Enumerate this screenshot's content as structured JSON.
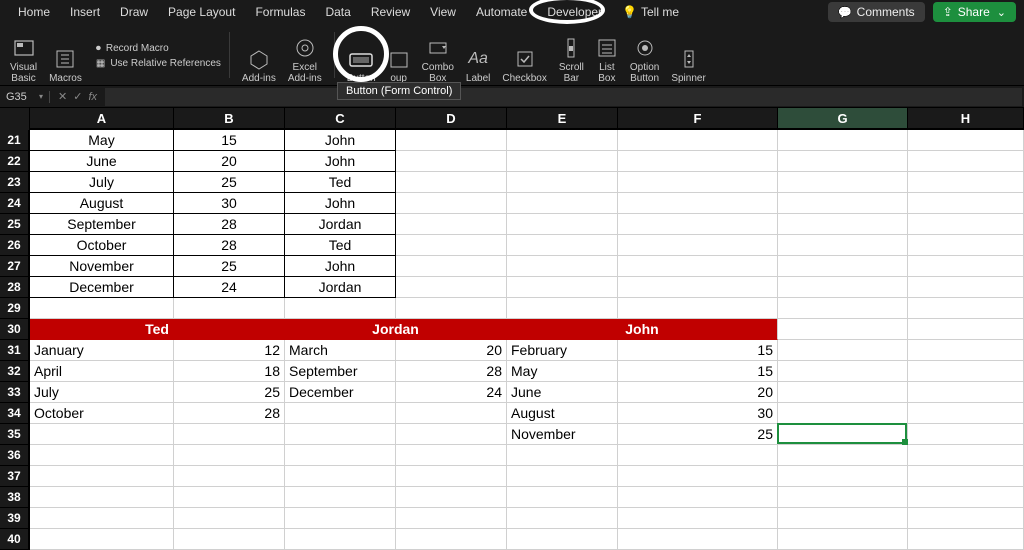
{
  "menubar": {
    "items": [
      "Home",
      "Insert",
      "Draw",
      "Page Layout",
      "Formulas",
      "Data",
      "Review",
      "View",
      "Automate",
      "Developer"
    ],
    "tellme": "Tell me",
    "comments": "Comments",
    "share": "Share"
  },
  "ribbon": {
    "visual_basic": "Visual\nBasic",
    "macros": "Macros",
    "record_macro": "Record Macro",
    "use_rel_refs": "Use Relative References",
    "addins": "Add-ins",
    "excel_addins": "Excel\nAdd-ins",
    "button": "Button",
    "group_box": "oup",
    "combo_box": "Combo\nBox",
    "label": "Label",
    "checkbox": "Checkbox",
    "scroll_bar": "Scroll\nBar",
    "list_box": "List\nBox",
    "option_button": "Option\nButton",
    "spinner": "Spinner",
    "tooltip": "Button (Form Control)"
  },
  "namebox": "G35",
  "columns": [
    "A",
    "B",
    "C",
    "D",
    "E",
    "F",
    "G",
    "H"
  ],
  "rows_visible": [
    21,
    22,
    23,
    24,
    25,
    26,
    27,
    28,
    29,
    30,
    31,
    32,
    33,
    34,
    35,
    36,
    37,
    38,
    39,
    40
  ],
  "top_table": [
    {
      "r": 21,
      "a": "May",
      "b": "15",
      "c": "John"
    },
    {
      "r": 22,
      "a": "June",
      "b": "20",
      "c": "John"
    },
    {
      "r": 23,
      "a": "July",
      "b": "25",
      "c": "Ted"
    },
    {
      "r": 24,
      "a": "August",
      "b": "30",
      "c": "John"
    },
    {
      "r": 25,
      "a": "September",
      "b": "28",
      "c": "Jordan"
    },
    {
      "r": 26,
      "a": "October",
      "b": "28",
      "c": "Ted"
    },
    {
      "r": 27,
      "a": "November",
      "b": "25",
      "c": "John"
    },
    {
      "r": 28,
      "a": "December",
      "b": "24",
      "c": "Jordan"
    }
  ],
  "red_headers": {
    "ab": "Ted",
    "cd": "Jordan",
    "ef": "John"
  },
  "bottom": {
    "ted": [
      {
        "m": "January",
        "v": "12"
      },
      {
        "m": "April",
        "v": "18"
      },
      {
        "m": "July",
        "v": "25"
      },
      {
        "m": "October",
        "v": "28"
      }
    ],
    "jordan": [
      {
        "m": "March",
        "v": "20"
      },
      {
        "m": "September",
        "v": "28"
      },
      {
        "m": "December",
        "v": "24"
      }
    ],
    "john": [
      {
        "m": "February",
        "v": "15"
      },
      {
        "m": "May",
        "v": "15"
      },
      {
        "m": "June",
        "v": "20"
      },
      {
        "m": "August",
        "v": "30"
      },
      {
        "m": "November",
        "v": "25"
      }
    ]
  },
  "active_cell": "G35"
}
